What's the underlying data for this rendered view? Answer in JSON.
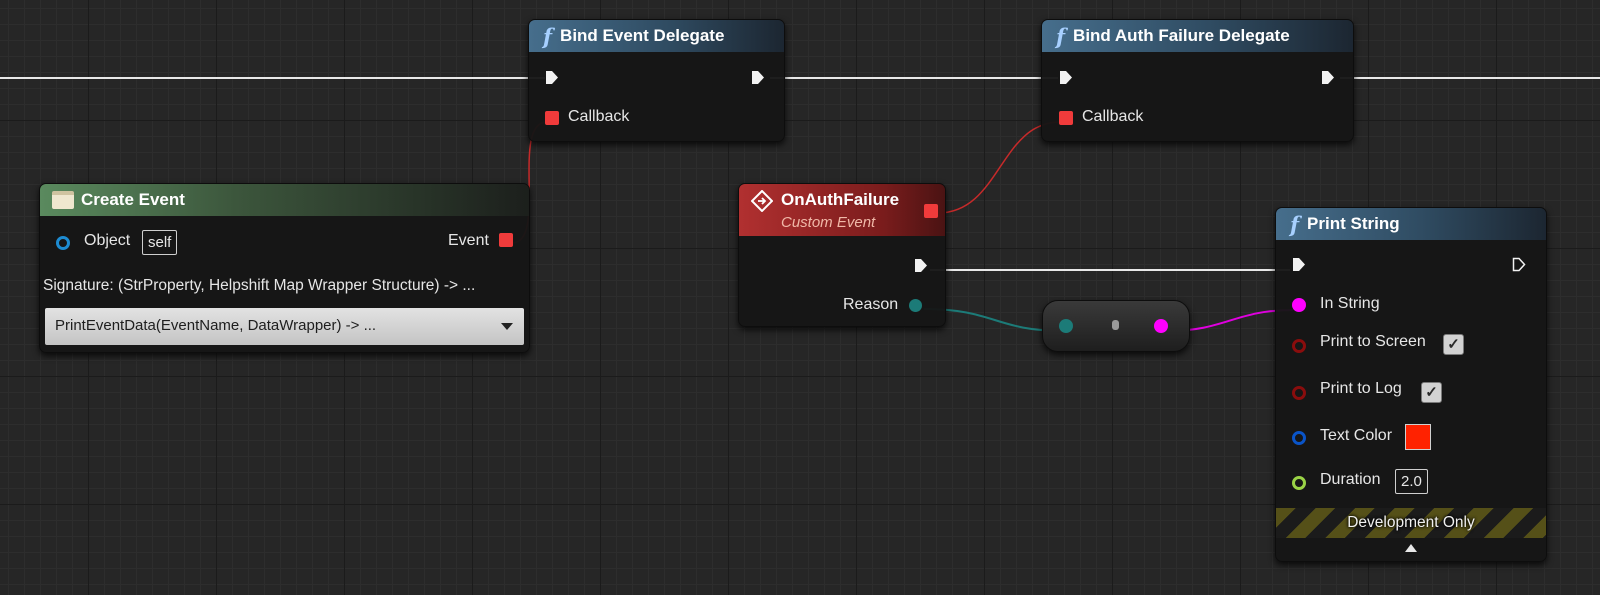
{
  "nodes": {
    "bind_event_delegate": {
      "title": "Bind Event Delegate",
      "callback_label": "Callback"
    },
    "bind_auth_failure_delegate": {
      "title": "Bind Auth Failure Delegate",
      "callback_label": "Callback"
    },
    "create_event": {
      "title": "Create Event",
      "object_label": "Object",
      "object_value": "self",
      "event_label": "Event",
      "signature": "Signature: (StrProperty, Helpshift Map Wrapper Structure) -> ...",
      "function_selected": "PrintEventData(EventName, DataWrapper) -> ..."
    },
    "on_auth_failure": {
      "title": "OnAuthFailure",
      "subtitle": "Custom Event",
      "reason_label": "Reason"
    },
    "print_string": {
      "title": "Print String",
      "in_string_label": "In String",
      "print_to_screen_label": "Print to Screen",
      "print_to_screen_checked": true,
      "print_to_log_label": "Print to Log",
      "print_to_log_checked": true,
      "text_color_label": "Text Color",
      "text_color_value": "#ff2200",
      "duration_label": "Duration",
      "duration_value": "2.0",
      "dev_banner": "Development Only"
    }
  },
  "colors": {
    "exec_wire": "#e8e8e8",
    "delegate_pin": "#f03b3b",
    "string_pin": "#ff00ff",
    "text_pin": "#1c7b78",
    "object_pin": "#1d8bd1",
    "bool_pin": "#8a0d0d",
    "struct_pin": "#0a54c8",
    "float_pin": "#9ad346",
    "function_header": "#466e8c",
    "event_header": "#b13030"
  },
  "icons": {
    "function": "function-icon",
    "create_event": "create-event-icon",
    "custom_event": "custom-event-icon"
  }
}
